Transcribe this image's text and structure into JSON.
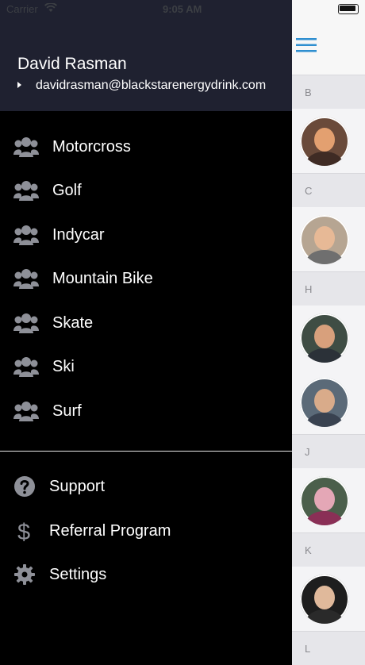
{
  "status_bar": {
    "carrier": "Carrier",
    "time": "9:05 AM"
  },
  "user": {
    "name": "David Rasman",
    "email": "davidrasman@blackstarenergydrink.com"
  },
  "groups": [
    {
      "label": "Motorcross",
      "icon": "group-icon"
    },
    {
      "label": "Golf",
      "icon": "group-icon"
    },
    {
      "label": "Indycar",
      "icon": "group-icon"
    },
    {
      "label": "Mountain Bike",
      "icon": "group-icon"
    },
    {
      "label": "Skate",
      "icon": "group-icon"
    },
    {
      "label": "Ski",
      "icon": "group-icon"
    },
    {
      "label": "Surf",
      "icon": "group-icon"
    }
  ],
  "utilities": [
    {
      "label": "Support",
      "icon": "help-icon"
    },
    {
      "label": "Referral Program",
      "icon": "dollar-icon"
    },
    {
      "label": "Settings",
      "icon": "gear-icon"
    }
  ],
  "background_list": {
    "sections": [
      "B",
      "C",
      "H",
      "J",
      "K",
      "L"
    ]
  },
  "colors": {
    "header_bg": "#1f2130",
    "drawer_bg": "#000000",
    "menu_accent": "#2f8fd0",
    "icon_gray": "#8e9098"
  }
}
